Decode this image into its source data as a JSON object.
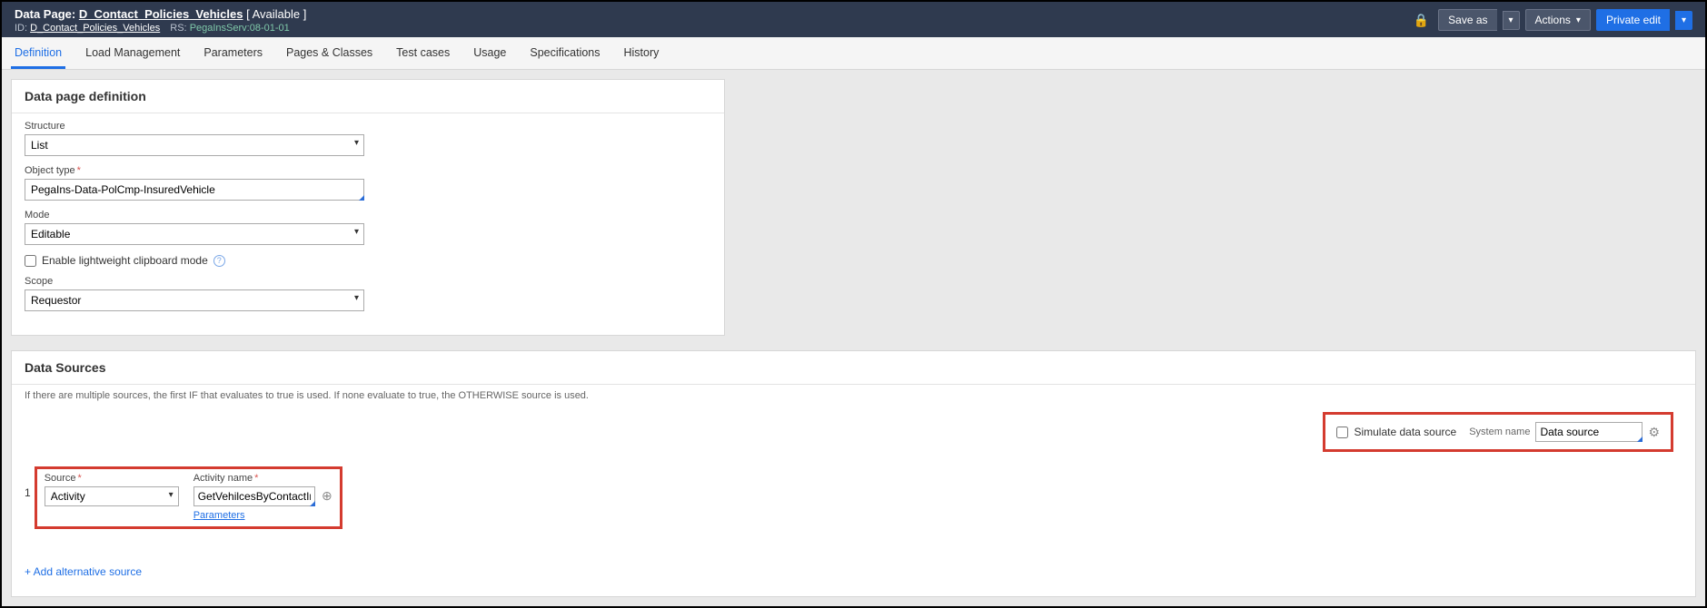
{
  "header": {
    "type_label": "Data Page:",
    "name": "D_Contact_Policies_Vehicles",
    "status": "[ Available ]",
    "id_label": "ID:",
    "id_value": "D_Contact_Policies_Vehicles",
    "rs_label": "RS:",
    "rs_value": "PegaInsServ:08-01-01"
  },
  "header_actions": {
    "save_as": "Save as",
    "actions": "Actions",
    "private_edit": "Private edit"
  },
  "tabs": [
    "Definition",
    "Load Management",
    "Parameters",
    "Pages & Classes",
    "Test cases",
    "Usage",
    "Specifications",
    "History"
  ],
  "definition_panel": {
    "title": "Data page definition",
    "structure_label": "Structure",
    "structure_value": "List",
    "object_type_label": "Object type",
    "object_type_value": "PegaIns-Data-PolCmp-InsuredVehicle",
    "mode_label": "Mode",
    "mode_value": "Editable",
    "lightweight_label": "Enable lightweight clipboard mode",
    "scope_label": "Scope",
    "scope_value": "Requestor"
  },
  "data_sources_panel": {
    "title": "Data Sources",
    "hint": "If there are multiple sources, the first IF that evaluates to true is used. If none evaluate to true, the OTHERWISE source is used.",
    "simulate_label": "Simulate data source",
    "system_name_label": "System name",
    "system_name_value": "Data source",
    "row_index": "1",
    "source_label": "Source",
    "source_value": "Activity",
    "activity_name_label": "Activity name",
    "activity_name_value": "GetVehilcesByContactInfo",
    "parameters_link": "Parameters",
    "add_source_link": "+ Add alternative source"
  }
}
